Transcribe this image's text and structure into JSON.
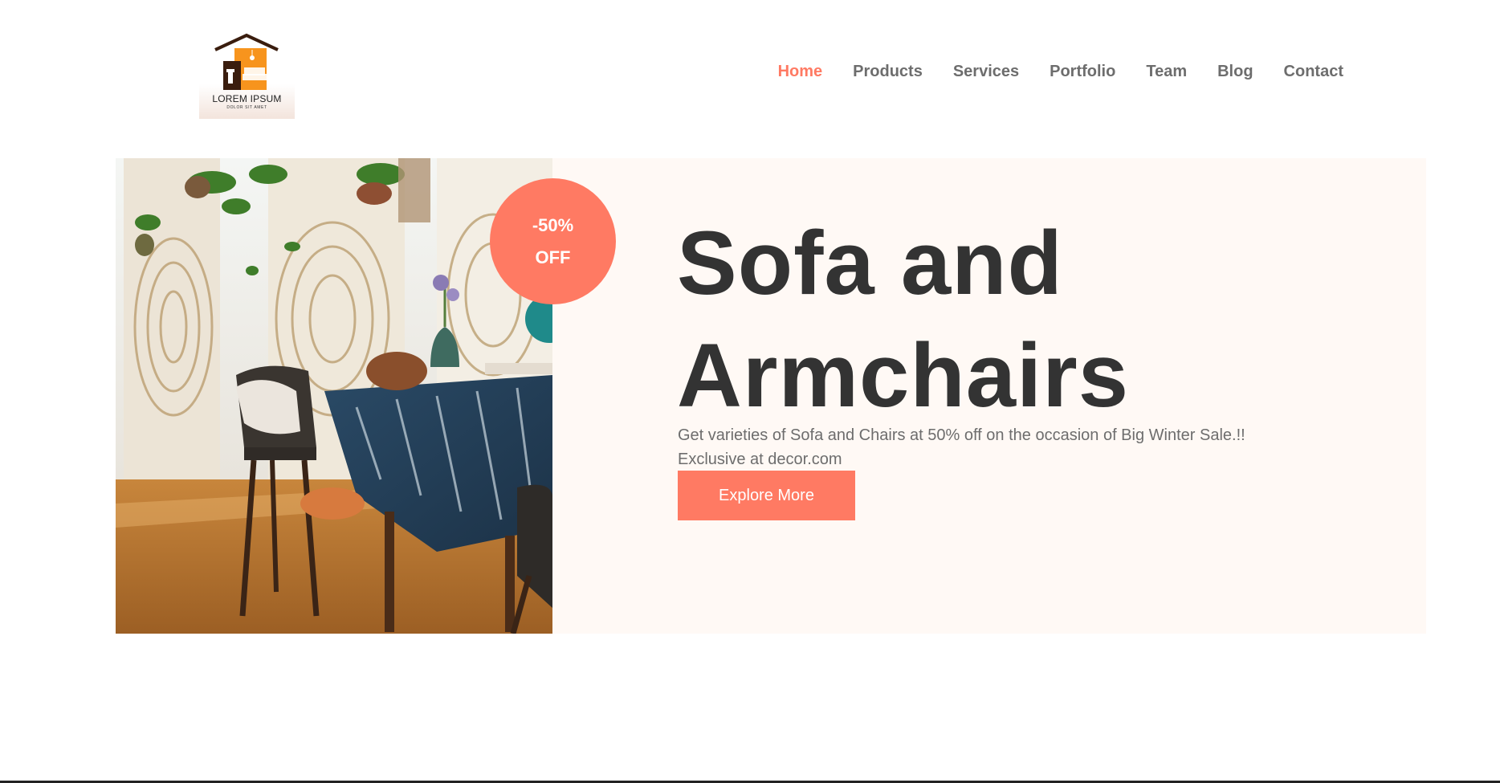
{
  "brand": {
    "logo_text": "LOREM IPSUM",
    "logo_subtext": "DOLOR SIT AMET",
    "logo_icon": "house-furniture-logo"
  },
  "nav": {
    "items": [
      {
        "label": "Home",
        "active": true
      },
      {
        "label": "Products",
        "active": false
      },
      {
        "label": "Services",
        "active": false
      },
      {
        "label": "Portfolio",
        "active": false
      },
      {
        "label": "Team",
        "active": false
      },
      {
        "label": "Blog",
        "active": false
      },
      {
        "label": "Contact",
        "active": false
      }
    ]
  },
  "hero": {
    "badge_line1": "-50%",
    "badge_line2": "OFF",
    "title_line1": "Sofa and",
    "title_line2": "Armchairs",
    "description_line1": "Get varieties of Sofa and Chairs at 50% off on the occasion of Big Winter Sale.!!",
    "description_line2": "Exclusive at decor.com",
    "cta_label": "Explore More",
    "photo": "boho-dining-room-photo"
  },
  "colors": {
    "accent": "#ff7a63",
    "nav_text": "#6d6d6d",
    "title_text": "#333333",
    "hero_bg": "#fff9f5"
  }
}
